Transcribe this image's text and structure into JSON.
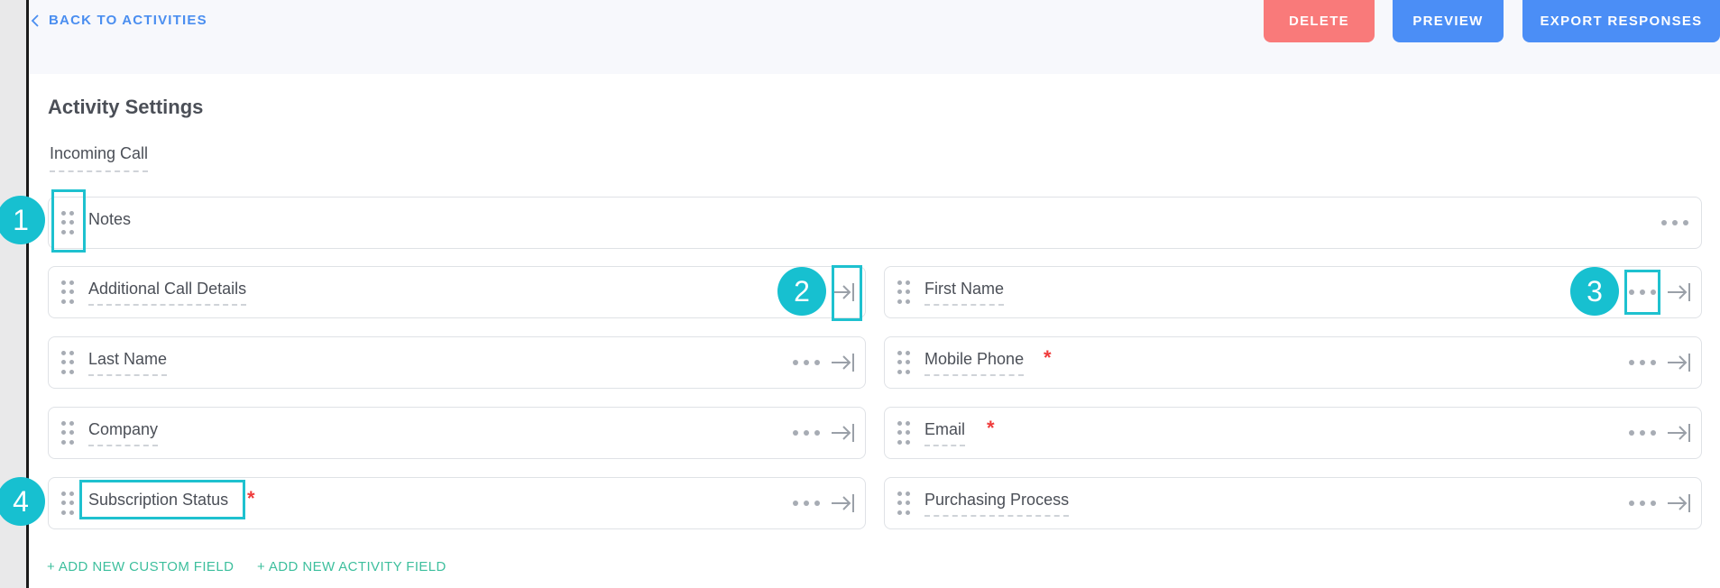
{
  "topbar": {
    "back_label": "BACK TO ACTIVITIES",
    "delete_label": "DELETE",
    "preview_label": "PREVIEW",
    "export_label": "EXPORT RESPONSES"
  },
  "settings": {
    "title": "Activity Settings",
    "activity_name": "Incoming Call"
  },
  "fields": {
    "notes": {
      "label": "Notes",
      "required": false
    },
    "additional_call_details": {
      "label": "Additional Call Details",
      "required": false
    },
    "first_name": {
      "label": "First Name",
      "required": false
    },
    "last_name": {
      "label": "Last Name",
      "required": false
    },
    "mobile_phone": {
      "label": "Mobile Phone",
      "required": true
    },
    "company": {
      "label": "Company",
      "required": false
    },
    "email": {
      "label": "Email",
      "required": true
    },
    "subscription_status": {
      "label": "Subscription Status",
      "required": true
    },
    "purchasing_process": {
      "label": "Purchasing Process",
      "required": false
    }
  },
  "required_marker": "*",
  "callouts": [
    "1",
    "2",
    "3",
    "4"
  ],
  "footer": {
    "add_custom_field": "+ ADD NEW CUSTOM FIELD",
    "add_activity_field": "+ ADD NEW ACTIVITY FIELD"
  },
  "colors": {
    "accent_blue": "#4b8ef6",
    "delete_red": "#f97a7a",
    "callout_teal": "#17c0d0",
    "add_link_green": "#3dbf9d",
    "required_red": "#ef3b3b"
  }
}
